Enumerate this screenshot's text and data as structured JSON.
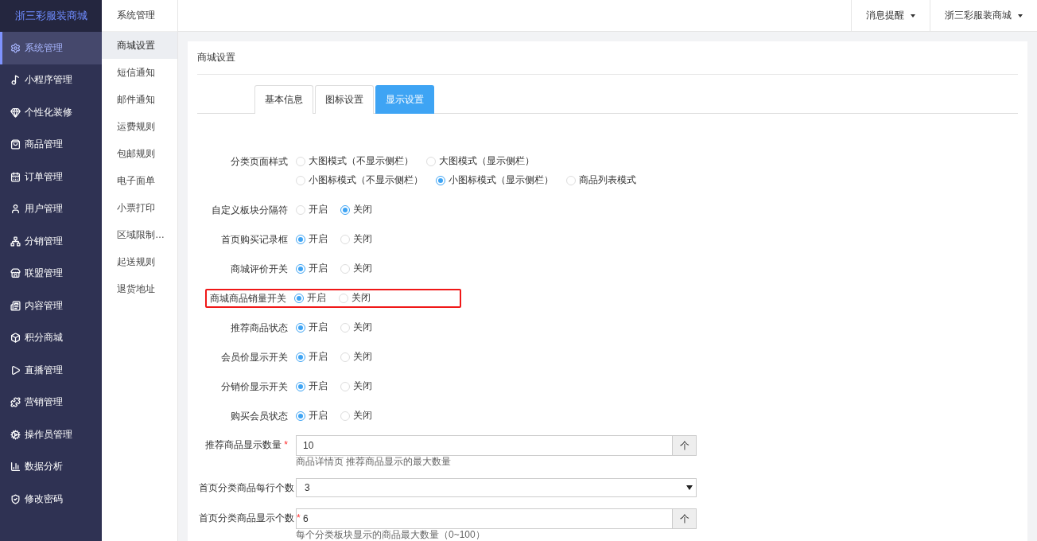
{
  "brand": "浙三彩服装商城",
  "sidebar": {
    "items": [
      {
        "label": "系统管理",
        "selected": true
      },
      {
        "label": "小程序管理",
        "selected": false
      },
      {
        "label": "个性化装修",
        "selected": false
      },
      {
        "label": "商品管理",
        "selected": false
      },
      {
        "label": "订单管理",
        "selected": false
      },
      {
        "label": "用户管理",
        "selected": false
      },
      {
        "label": "分销管理",
        "selected": false
      },
      {
        "label": "联盟管理",
        "selected": false
      },
      {
        "label": "内容管理",
        "selected": false
      },
      {
        "label": "积分商城",
        "selected": false
      },
      {
        "label": "直播管理",
        "selected": false
      },
      {
        "label": "营销管理",
        "selected": false
      },
      {
        "label": "操作员管理",
        "selected": false
      },
      {
        "label": "数据分析",
        "selected": false
      },
      {
        "label": "修改密码",
        "selected": false
      }
    ]
  },
  "submenu": {
    "title": "系统管理",
    "items": [
      {
        "label": "商城设置",
        "selected": true
      },
      {
        "label": "短信通知",
        "selected": false
      },
      {
        "label": "邮件通知",
        "selected": false
      },
      {
        "label": "运费规则",
        "selected": false
      },
      {
        "label": "包邮规则",
        "selected": false
      },
      {
        "label": "电子面单",
        "selected": false
      },
      {
        "label": "小票打印",
        "selected": false
      },
      {
        "label": "区域限制…",
        "selected": false
      },
      {
        "label": "起送规则",
        "selected": false
      },
      {
        "label": "退货地址",
        "selected": false
      }
    ]
  },
  "topbar": {
    "menus": [
      "消息提醒",
      "浙三彩服装商城"
    ]
  },
  "panel": {
    "title": "商城设置",
    "tabs": [
      {
        "label": "基本信息",
        "selected": false
      },
      {
        "label": "图标设置",
        "selected": false
      },
      {
        "label": "显示设置",
        "selected": true
      }
    ],
    "fields": [
      {
        "kind": "radio",
        "label": "分类页面样式",
        "highlighted": false,
        "options": [
          {
            "label": "大图模式（不显示侧栏）",
            "selected": false
          },
          {
            "label": "大图模式（显示侧栏）",
            "selected": false
          },
          {
            "label": "小图标模式（不显示侧栏）",
            "selected": false
          },
          {
            "label": "小图标模式（显示侧栏）",
            "selected": true
          },
          {
            "label": "商品列表模式",
            "selected": false
          }
        ]
      },
      {
        "kind": "radio",
        "label": "自定义板块分隔符",
        "highlighted": false,
        "options": [
          {
            "label": "开启",
            "selected": false
          },
          {
            "label": "关闭",
            "selected": true
          }
        ]
      },
      {
        "kind": "radio",
        "label": "首页购买记录框",
        "highlighted": false,
        "options": [
          {
            "label": "开启",
            "selected": true
          },
          {
            "label": "关闭",
            "selected": false
          }
        ]
      },
      {
        "kind": "radio",
        "label": "商城评价开关",
        "highlighted": false,
        "options": [
          {
            "label": "开启",
            "selected": true
          },
          {
            "label": "关闭",
            "selected": false
          }
        ]
      },
      {
        "kind": "radio",
        "label": "商城商品销量开关",
        "highlighted": true,
        "options": [
          {
            "label": "开启",
            "selected": true
          },
          {
            "label": "关闭",
            "selected": false
          }
        ]
      },
      {
        "kind": "radio",
        "label": "推荐商品状态",
        "highlighted": false,
        "options": [
          {
            "label": "开启",
            "selected": true
          },
          {
            "label": "关闭",
            "selected": false
          }
        ]
      },
      {
        "kind": "radio",
        "label": "会员价显示开关",
        "highlighted": false,
        "options": [
          {
            "label": "开启",
            "selected": true
          },
          {
            "label": "关闭",
            "selected": false
          }
        ]
      },
      {
        "kind": "radio",
        "label": "分销价显示开关",
        "highlighted": false,
        "options": [
          {
            "label": "开启",
            "selected": true
          },
          {
            "label": "关闭",
            "selected": false
          }
        ]
      },
      {
        "kind": "radio",
        "label": "购买会员状态",
        "highlighted": false,
        "options": [
          {
            "label": "开启",
            "selected": true
          },
          {
            "label": "关闭",
            "selected": false
          }
        ]
      },
      {
        "kind": "number",
        "label": "推荐商品显示数量",
        "required_mark": "*",
        "value": "10",
        "addon": "个",
        "hint": "商品详情页 推荐商品显示的最大数量"
      },
      {
        "kind": "select",
        "label": "首页分类商品每行个数",
        "value": "3"
      },
      {
        "kind": "number",
        "label": "首页分类商品显示个数",
        "required_mark": "*",
        "value": "6",
        "addon": "个",
        "hint": "每个分类板块显示的商品最大数量（0~100）"
      }
    ]
  }
}
